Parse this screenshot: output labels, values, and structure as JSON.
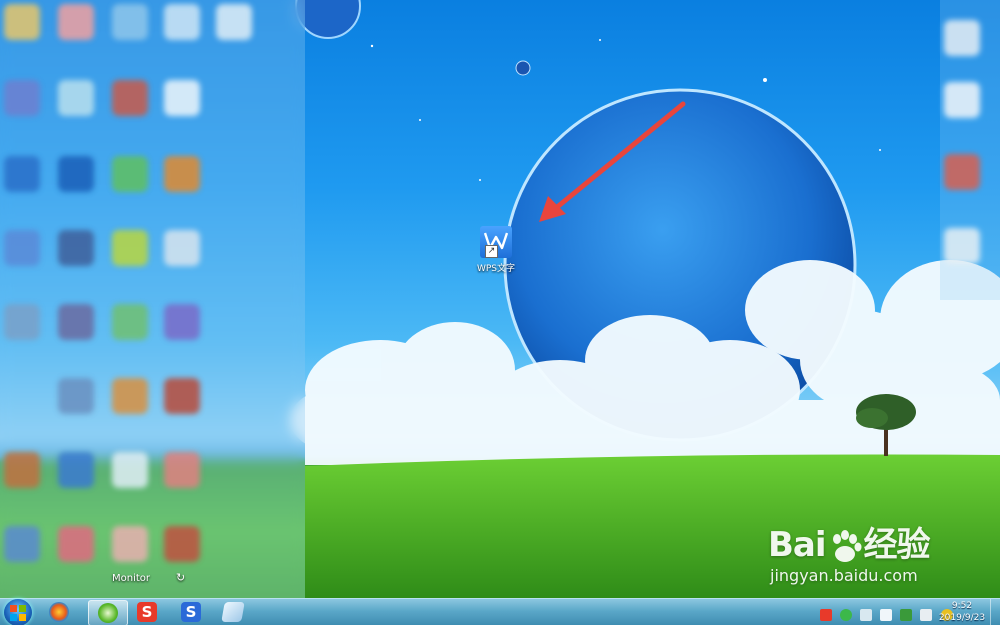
{
  "desktop": {
    "shortcut_label": "WPS文字",
    "blurred_label": "Monitor",
    "blurred_glyph": "↻"
  },
  "watermark": {
    "brand_left": "Bai",
    "brand_right": "经验",
    "url": "jingyan.baidu.com"
  },
  "taskbar": {
    "buttons": [
      {
        "icon": "windows-start-icon"
      },
      {
        "icon": "app-launcher-icon"
      },
      {
        "icon": "browser-360-icon",
        "active": true
      },
      {
        "icon": "wps-s-red-icon",
        "letter": "S"
      },
      {
        "icon": "sogou-s-blue-icon",
        "letter": "S"
      },
      {
        "icon": "notepad-icon"
      }
    ],
    "tray_icons": [
      "wps-tray-icon",
      "green-app-icon",
      "usb-icon",
      "network-icon",
      "shield-icon",
      "volume-icon",
      "security-icon"
    ],
    "clock": {
      "time": "9:52",
      "date": "2019/9/23"
    }
  },
  "colors": {
    "accent_red_arrow": "#e8453c",
    "sky": "#1f9af0",
    "grass": "#4fb828"
  }
}
